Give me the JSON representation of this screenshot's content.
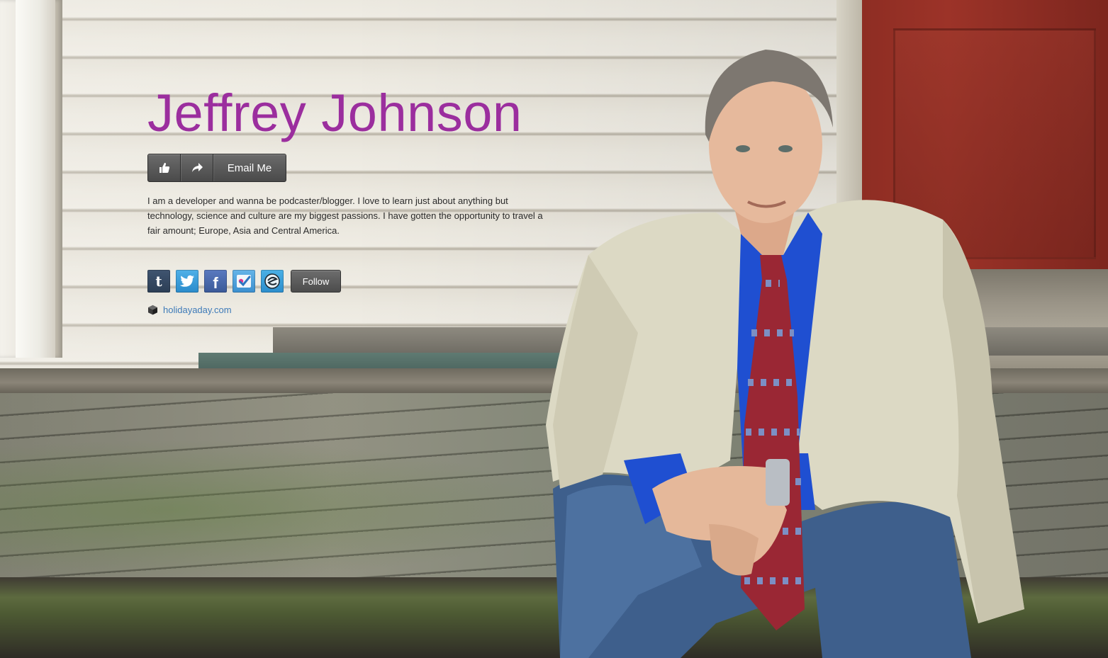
{
  "profile": {
    "name": "Jeffrey Johnson",
    "bio": "I am a developer and wanna be podcaster/blogger. I love to learn just about anything but technology, science and culture are my biggest passions. I have gotten the opportunity to travel a fair amount; Europe, Asia and Central America.",
    "accent_color": "#9b2e9e"
  },
  "actions": {
    "like_icon": "thumbs-up-icon",
    "share_icon": "share-arrow-icon",
    "email_label": "Email Me"
  },
  "social": {
    "links": [
      {
        "network": "tumblr",
        "glyph": "t",
        "icon": "tumblr-icon"
      },
      {
        "network": "twitter",
        "icon": "twitter-icon"
      },
      {
        "network": "facebook",
        "glyph": "f",
        "icon": "facebook-icon"
      },
      {
        "network": "foursquare",
        "icon": "foursquare-icon"
      },
      {
        "network": "other",
        "icon": "link-service-icon"
      }
    ],
    "follow_label": "Follow"
  },
  "website": {
    "icon": "cube-icon",
    "label": "holidayaday.com",
    "link_color": "#3d7ab8"
  }
}
